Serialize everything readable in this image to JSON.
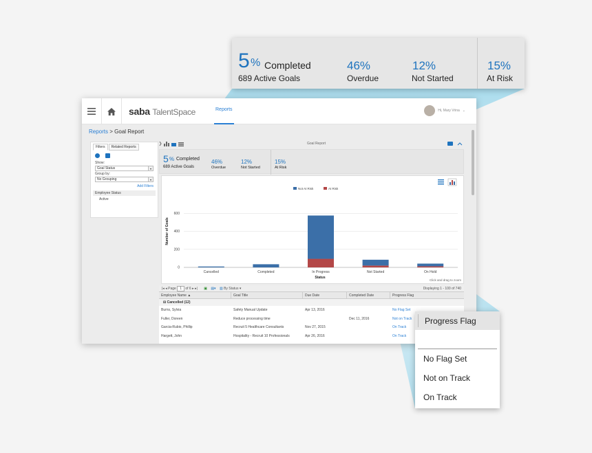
{
  "app": {
    "logo": "saba",
    "logo_sub": "TalentSpace",
    "nav_tab": "Reports",
    "user_greeting": "Hi, Mary Vrina"
  },
  "breadcrumb": {
    "root": "Reports",
    "sep": " > ",
    "current": "Goal Report"
  },
  "filters": {
    "tabs": [
      "Filters",
      "Related Reports"
    ],
    "show_label": "Show:",
    "show_value": "Goal Status",
    "group_label": "Group by:",
    "group_value": "No Grouping",
    "add_filters": "Add Filters",
    "employee_status_label": "Employee Status",
    "employee_status_value": "Active"
  },
  "report": {
    "title": "Goal Report",
    "summary": {
      "completed_pct": "5",
      "pct_sign": "%",
      "completed_label": "Completed",
      "active_goals": "689 Active Goals",
      "overdue_value": "46%",
      "overdue_label": "Overdue",
      "not_started_value": "12%",
      "not_started_label": "Not Started",
      "at_risk_value": "15%",
      "at_risk_label": "At Risk"
    },
    "chart_hint": "Click and drag to zoom"
  },
  "chart_data": {
    "type": "bar",
    "stacked": true,
    "categories": [
      "Cancelled",
      "Completed",
      "In Progress",
      "Not Started",
      "On Hold"
    ],
    "series": [
      {
        "name": "Not At Risk",
        "values": [
          10,
          35,
          480,
          65,
          30
        ]
      },
      {
        "name": "At Risk",
        "values": [
          0,
          0,
          95,
          20,
          12
        ]
      }
    ],
    "xlabel": "Status",
    "ylabel": "Number of Goals",
    "ylim": [
      0,
      800
    ],
    "yticks": [
      0,
      200,
      400,
      600
    ],
    "grid": true,
    "legend": "top-center",
    "colors": {
      "Not At Risk": "#3b6fa8",
      "At Risk": "#b34747"
    }
  },
  "table": {
    "pager": {
      "page_label": "Page",
      "page": "1",
      "of": "of 6",
      "group_by": "By Status",
      "displaying": "Displaying 1 - 100 of 740"
    },
    "columns": [
      "Employee Name ▲",
      "Goal Title",
      "Due Date",
      "Completed Date",
      "Progress Flag"
    ],
    "group": "Cancelled (12)",
    "rows": [
      [
        "Burns, Sylvia",
        "Safety Manual Update",
        "Apr 13, 2016",
        "",
        "No Flag Set"
      ],
      [
        "Fuller, Doreen",
        "Reduce processing time",
        "",
        "Dec 11, 2016",
        "Not on Track"
      ],
      [
        "Garcia-Rubio, Phillip",
        "Recruit 5 Healthcare Consultants",
        "Nov 27, 2015",
        "",
        "On Track"
      ],
      [
        "Hargett, John",
        "Hospitality - Recruit 10 Professionals",
        "Apr 26, 2016",
        "",
        "On Track"
      ]
    ]
  },
  "flag_dropdown": {
    "header": "Progress Flag",
    "options": [
      "No Flag Set",
      "Not on Track",
      "On Track"
    ]
  },
  "colors": {
    "accent": "#1e73be",
    "link": "#2a7fd4",
    "beam": "#8fd3ec"
  }
}
